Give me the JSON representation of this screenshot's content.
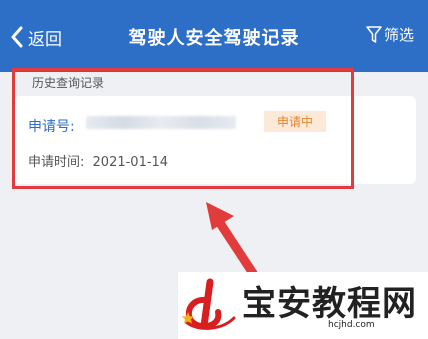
{
  "header": {
    "back_label": "返回",
    "title": "驾驶人安全驾驶记录",
    "filter_label": "筛选"
  },
  "section": {
    "label": "历史查询记录"
  },
  "record": {
    "application_no_label": "申请号:",
    "status": "申请中",
    "date_label": "申请时间:",
    "date_value": "2021-01-14"
  },
  "watermark": {
    "text": "宝安教程网",
    "url": "hcjhd.com"
  },
  "colors": {
    "header_bg": "#2d6ec6",
    "accent_blue": "#2d6ec6",
    "highlight_red": "#e23b3b",
    "badge_bg": "#fde9d7",
    "badge_text": "#e8852e"
  }
}
